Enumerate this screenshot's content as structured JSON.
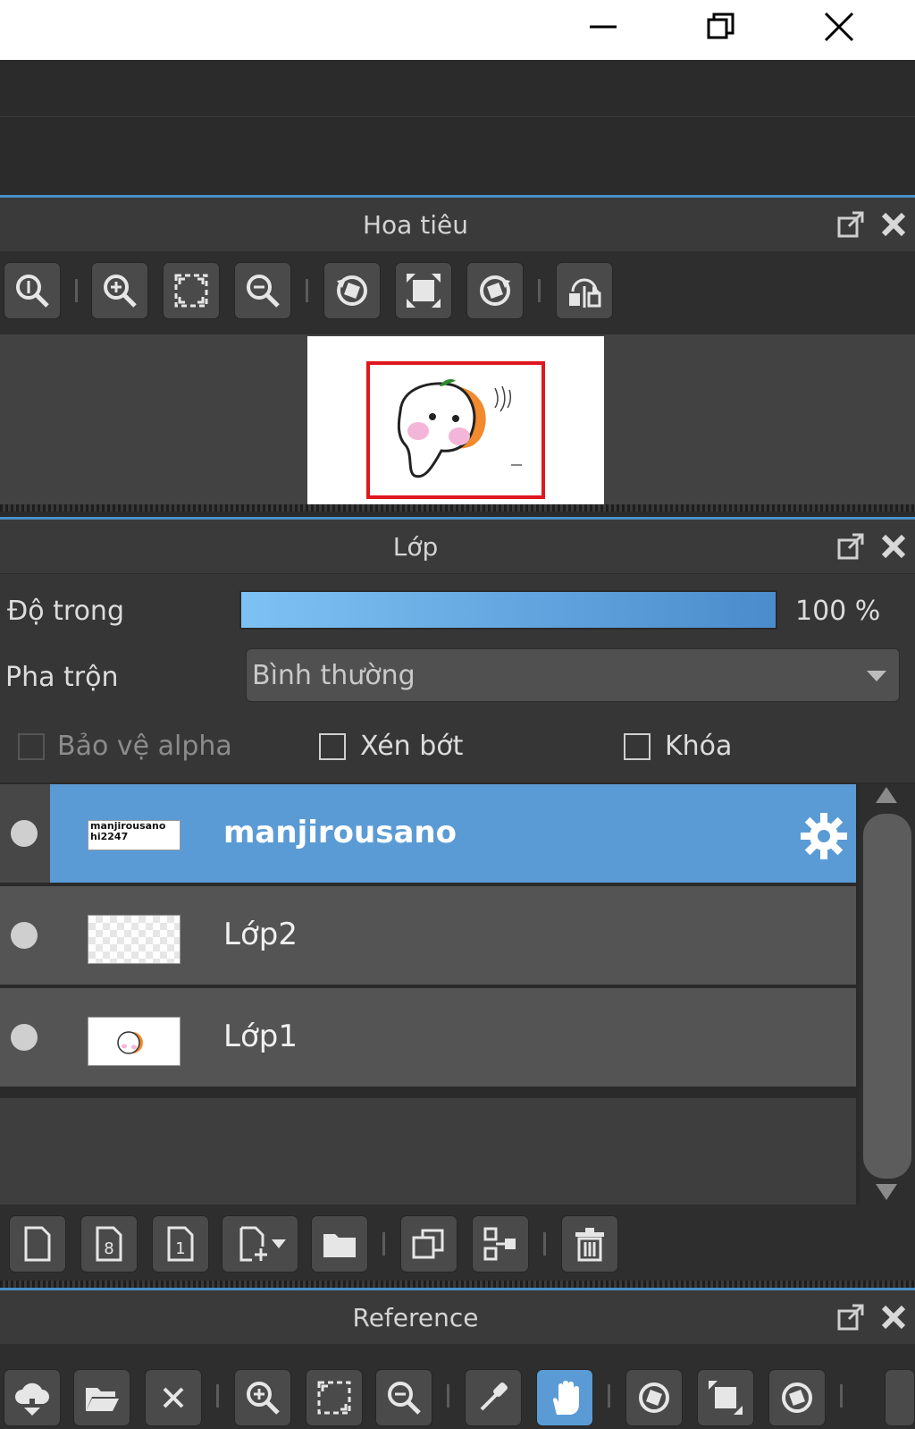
{
  "window": {
    "minimize_icon": "minimize-icon",
    "restore_icon": "restore-icon",
    "close_icon": "close-icon"
  },
  "navigator": {
    "title": "Hoa tiêu",
    "tools": [
      "zoom-actual-icon",
      "zoom-in-icon",
      "fit-icon",
      "zoom-out-icon",
      "rotate-left-icon",
      "reset-rotation-icon",
      "rotate-right-icon",
      "flip-icon"
    ]
  },
  "layers": {
    "title": "Lớp",
    "opacity_label": "Độ trong",
    "opacity_value": "100 %",
    "opacity_fraction": 1.0,
    "blend_label": "Pha trộn",
    "blend_value": "Bình thường",
    "protect_alpha": "Bảo vệ alpha",
    "clip": "Xén bớt",
    "lock": "Khóa",
    "items": [
      {
        "name": "manjirousano",
        "selected": true,
        "thumb_text": "manjirousano hi2247"
      },
      {
        "name": "Lớp2",
        "selected": false
      },
      {
        "name": "Lớp1",
        "selected": false
      }
    ],
    "selection_color": "#5b9bd5"
  },
  "reference": {
    "title": "Reference"
  }
}
